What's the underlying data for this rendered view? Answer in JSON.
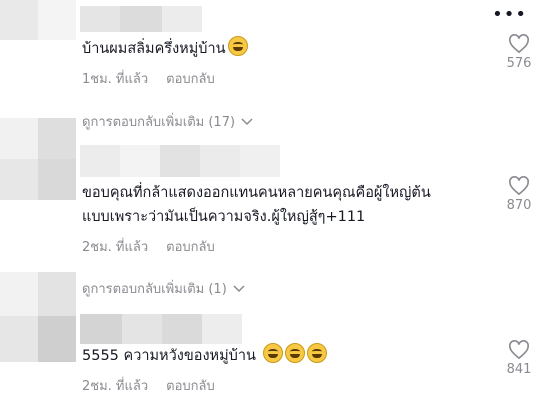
{
  "header": {
    "more_label": "•••"
  },
  "comments": [
    {
      "text": "บ้านผมสลิ่มครึ่งหมู่บ้าน",
      "emoji_count": 1,
      "time": "1ชม. ที่แล้ว",
      "reply_label": "ตอบกลับ",
      "likes": "576",
      "more_replies": "ดูการตอบกลับเพิ่มเติม (17)"
    },
    {
      "text_line1": "ขอบคุณที่กล้าแสดงออกแทนคนหลายคนคุณคือผู้ใหญ่ต้น",
      "text_line2": "แบบเพราะว่ามันเป็นความจริง.ผู้ใหญ่สู้ๆ+111",
      "time": "2ชม. ที่แล้ว",
      "reply_label": "ตอบกลับ",
      "likes": "870",
      "more_replies": "ดูการตอบกลับเพิ่มเติม (1)"
    },
    {
      "text": "5555 ความหวังของหมู่บ้าน",
      "emoji_count": 3,
      "time": "2ชม. ที่แล้ว",
      "reply_label": "ตอบกลับ",
      "likes": "841"
    }
  ],
  "colors": {
    "text": "#161823",
    "muted": "#8a8b91",
    "background": "#ffffff"
  },
  "icons": {
    "like": "heart-outline-icon",
    "expand": "chevron-down-icon",
    "more": "more-dots-icon"
  }
}
